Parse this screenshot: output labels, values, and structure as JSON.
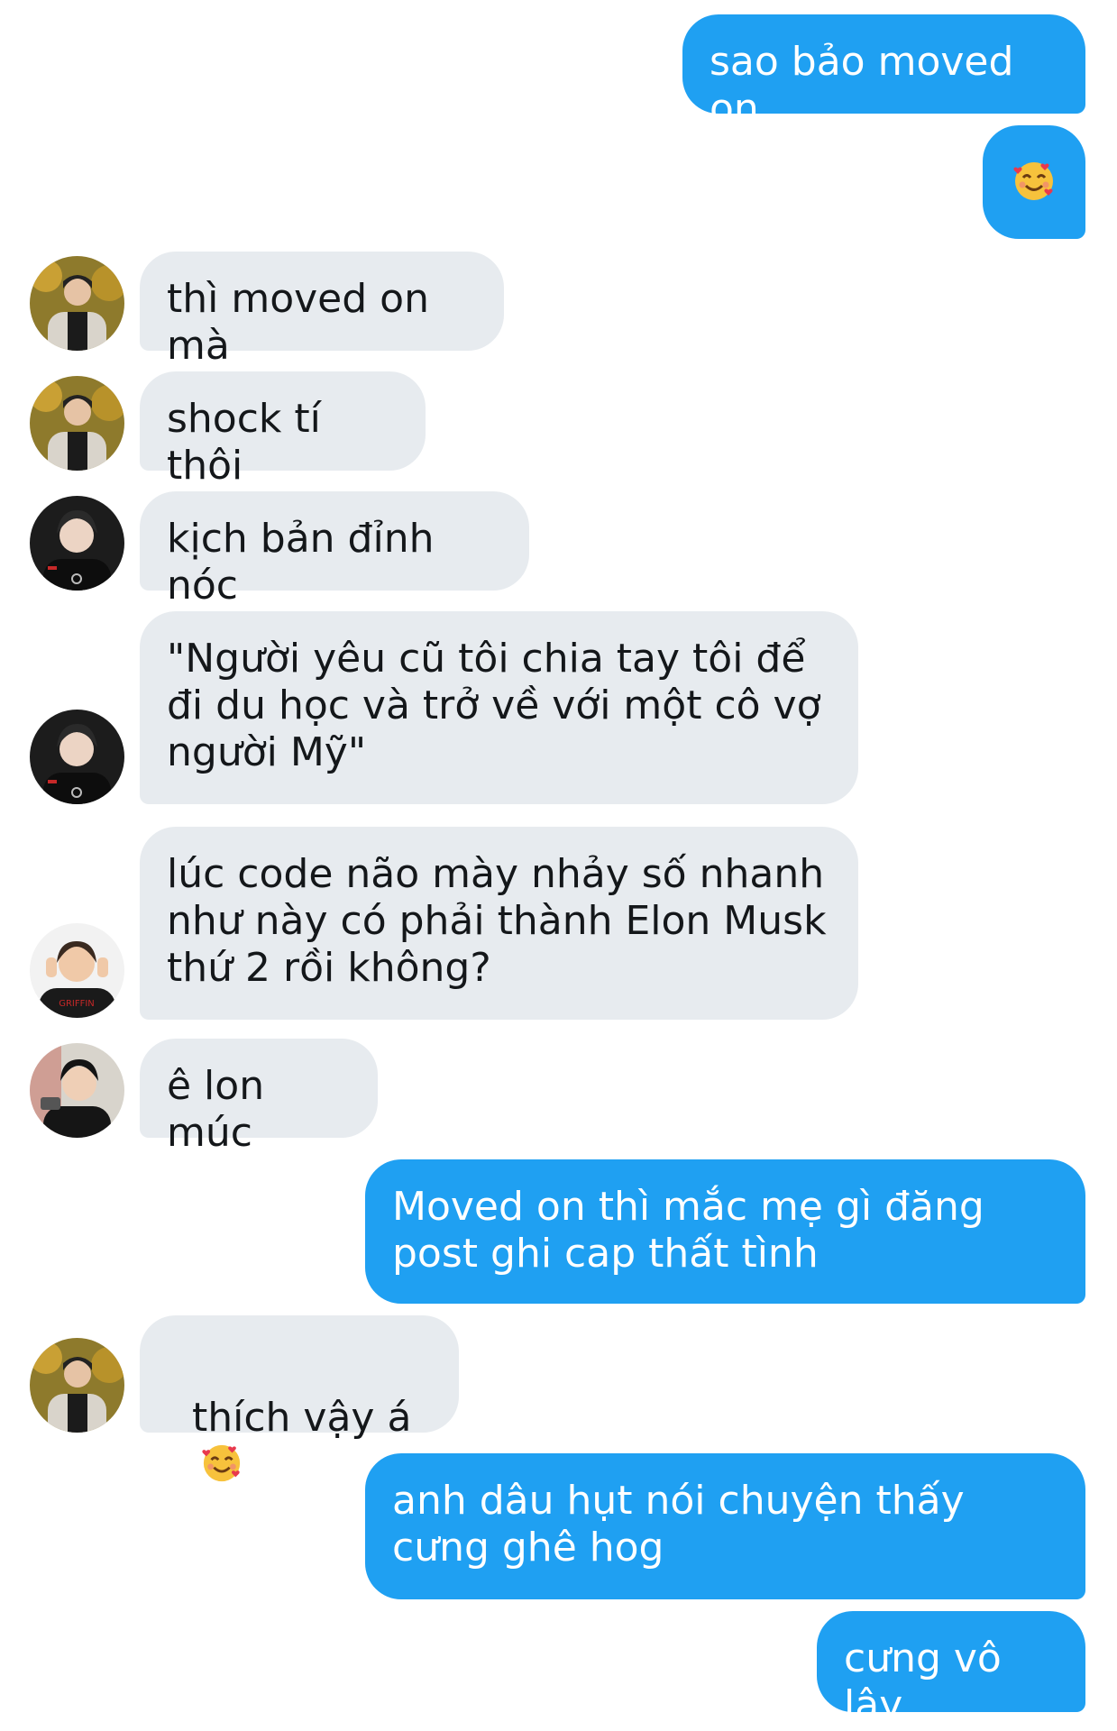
{
  "messages": [
    {
      "text": "sao bảo moved on"
    },
    {
      "text": "🥰"
    },
    {
      "text": "thì moved on mà"
    },
    {
      "text": "shock tí thôi"
    },
    {
      "text": "kịch bản đỉnh nóc"
    },
    {
      "text": "\"Người yêu cũ tôi chia tay tôi để đi du học và trở về với một cô vợ người Mỹ\""
    },
    {
      "text": "lúc code não mày nhảy số nhanh như này có phải thành Elon Musk thứ 2 rồi không?"
    },
    {
      "text": "ê lon múc"
    },
    {
      "text": "Moved on thì mắc mẹ gì đăng post ghi cap thất tình"
    },
    {
      "text": "thích vậy á"
    },
    {
      "text": "anh dâu hụt nói chuyện thấy cưng ghê hog"
    },
    {
      "text": "cưng vô lây"
    }
  ],
  "colors": {
    "outgoing_bubble": "#1fa0f2",
    "incoming_bubble": "#e7ebef",
    "background": "#ffffff"
  }
}
